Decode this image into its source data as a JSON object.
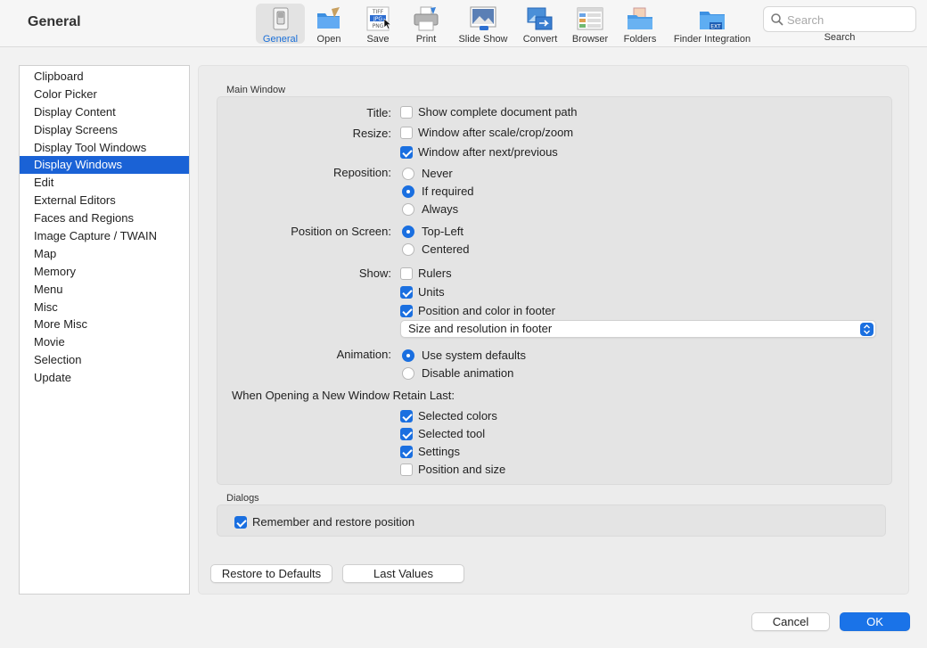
{
  "window": {
    "title": "General"
  },
  "toolbar": {
    "items": [
      {
        "label": "General"
      },
      {
        "label": "Open"
      },
      {
        "label": "Save"
      },
      {
        "label": "Print"
      },
      {
        "label": "Slide Show"
      },
      {
        "label": "Convert"
      },
      {
        "label": "Browser"
      },
      {
        "label": "Folders"
      },
      {
        "label": "Finder Integration"
      }
    ],
    "save_icon_text": [
      "TIFF",
      "JPG",
      "PNG"
    ],
    "finder_icon_text": "EXT",
    "search": {
      "placeholder": "Search",
      "value": "",
      "label": "Search"
    }
  },
  "sidebar": {
    "items": [
      "Clipboard",
      "Color Picker",
      "Display Content",
      "Display Screens",
      "Display Tool Windows",
      "Display Windows",
      "Edit",
      "External Editors",
      "Faces and Regions",
      "Image Capture / TWAIN",
      "Map",
      "Memory",
      "Menu",
      "Misc",
      "More Misc",
      "Movie",
      "Selection",
      "Update"
    ],
    "selected": "Display Windows"
  },
  "main_window": {
    "group_title": "Main Window",
    "title_label": "Title:",
    "show_path": {
      "label": "Show complete document path",
      "checked": false
    },
    "resize_label": "Resize:",
    "resize_scale": {
      "label": "Window after scale/crop/zoom",
      "checked": false
    },
    "resize_next": {
      "label": "Window after next/previous",
      "checked": true
    },
    "reposition_label": "Reposition:",
    "reposition": [
      "Never",
      "If required",
      "Always"
    ],
    "reposition_selected": "If required",
    "position_label": "Position on Screen:",
    "position": [
      "Top-Left",
      "Centered"
    ],
    "position_selected": "Top-Left",
    "show_label": "Show:",
    "show_rulers": {
      "label": "Rulers",
      "checked": false
    },
    "show_units": {
      "label": "Units",
      "checked": true
    },
    "show_position": {
      "label": "Position and color in footer",
      "checked": true
    },
    "footer_select": "Size and resolution in footer",
    "animation_label": "Animation:",
    "animation": [
      "Use system defaults",
      "Disable animation"
    ],
    "animation_selected": "Use system defaults",
    "retain_label": "When Opening a New Window Retain Last:",
    "retain_colors": {
      "label": "Selected colors",
      "checked": true
    },
    "retain_tool": {
      "label": "Selected tool",
      "checked": true
    },
    "retain_settings": {
      "label": "Settings",
      "checked": true
    },
    "retain_possize": {
      "label": "Position and size",
      "checked": false
    }
  },
  "dialogs": {
    "group_title": "Dialogs",
    "remember": {
      "label": "Remember and restore position",
      "checked": true
    }
  },
  "buttons": {
    "restore": "Restore to Defaults",
    "last_values": "Last Values",
    "cancel": "Cancel",
    "ok": "OK"
  },
  "colors": {
    "accent": "#1a6fe0",
    "selection": "#1a62d6"
  }
}
